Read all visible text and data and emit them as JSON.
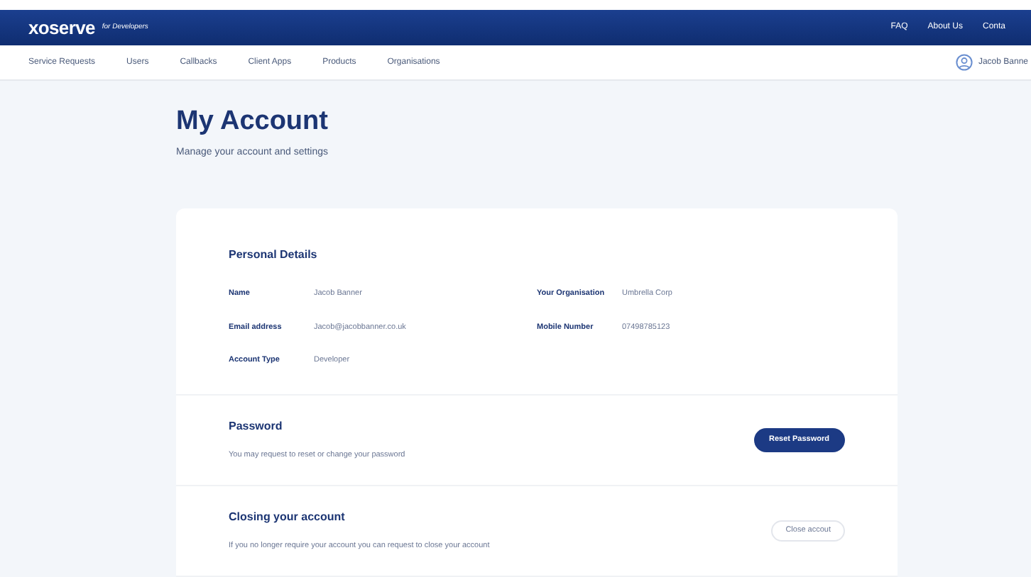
{
  "header": {
    "logo": "xoserve",
    "logo_tag": "for Developers",
    "links": [
      "FAQ",
      "About Us",
      "Conta"
    ]
  },
  "nav": {
    "items": [
      "Service Requests",
      "Users",
      "Callbacks",
      "Client Apps",
      "Products",
      "Organisations"
    ],
    "user": "Jacob Banne"
  },
  "page": {
    "title": "My Account",
    "subtitle": "Manage your account and settings"
  },
  "personal_details": {
    "title": "Personal Details",
    "fields": [
      {
        "label": "Name",
        "value": "Jacob Banner"
      },
      {
        "label": "Your Organisation",
        "value": "Umbrella Corp"
      },
      {
        "label": "Email address",
        "value": "Jacob@jacobbanner.co.uk"
      },
      {
        "label": "Mobile Number",
        "value": "07498785123"
      },
      {
        "label": "Account Type",
        "value": "Developer"
      }
    ]
  },
  "sections": [
    {
      "kind": "primary",
      "title": "Password",
      "text": "You may request to reset or change your password",
      "button": "Reset Password"
    },
    {
      "kind": "outline",
      "title": "Closing your account",
      "text": "If you no longer require your account you can request to close your account",
      "button": "Close accout"
    }
  ]
}
